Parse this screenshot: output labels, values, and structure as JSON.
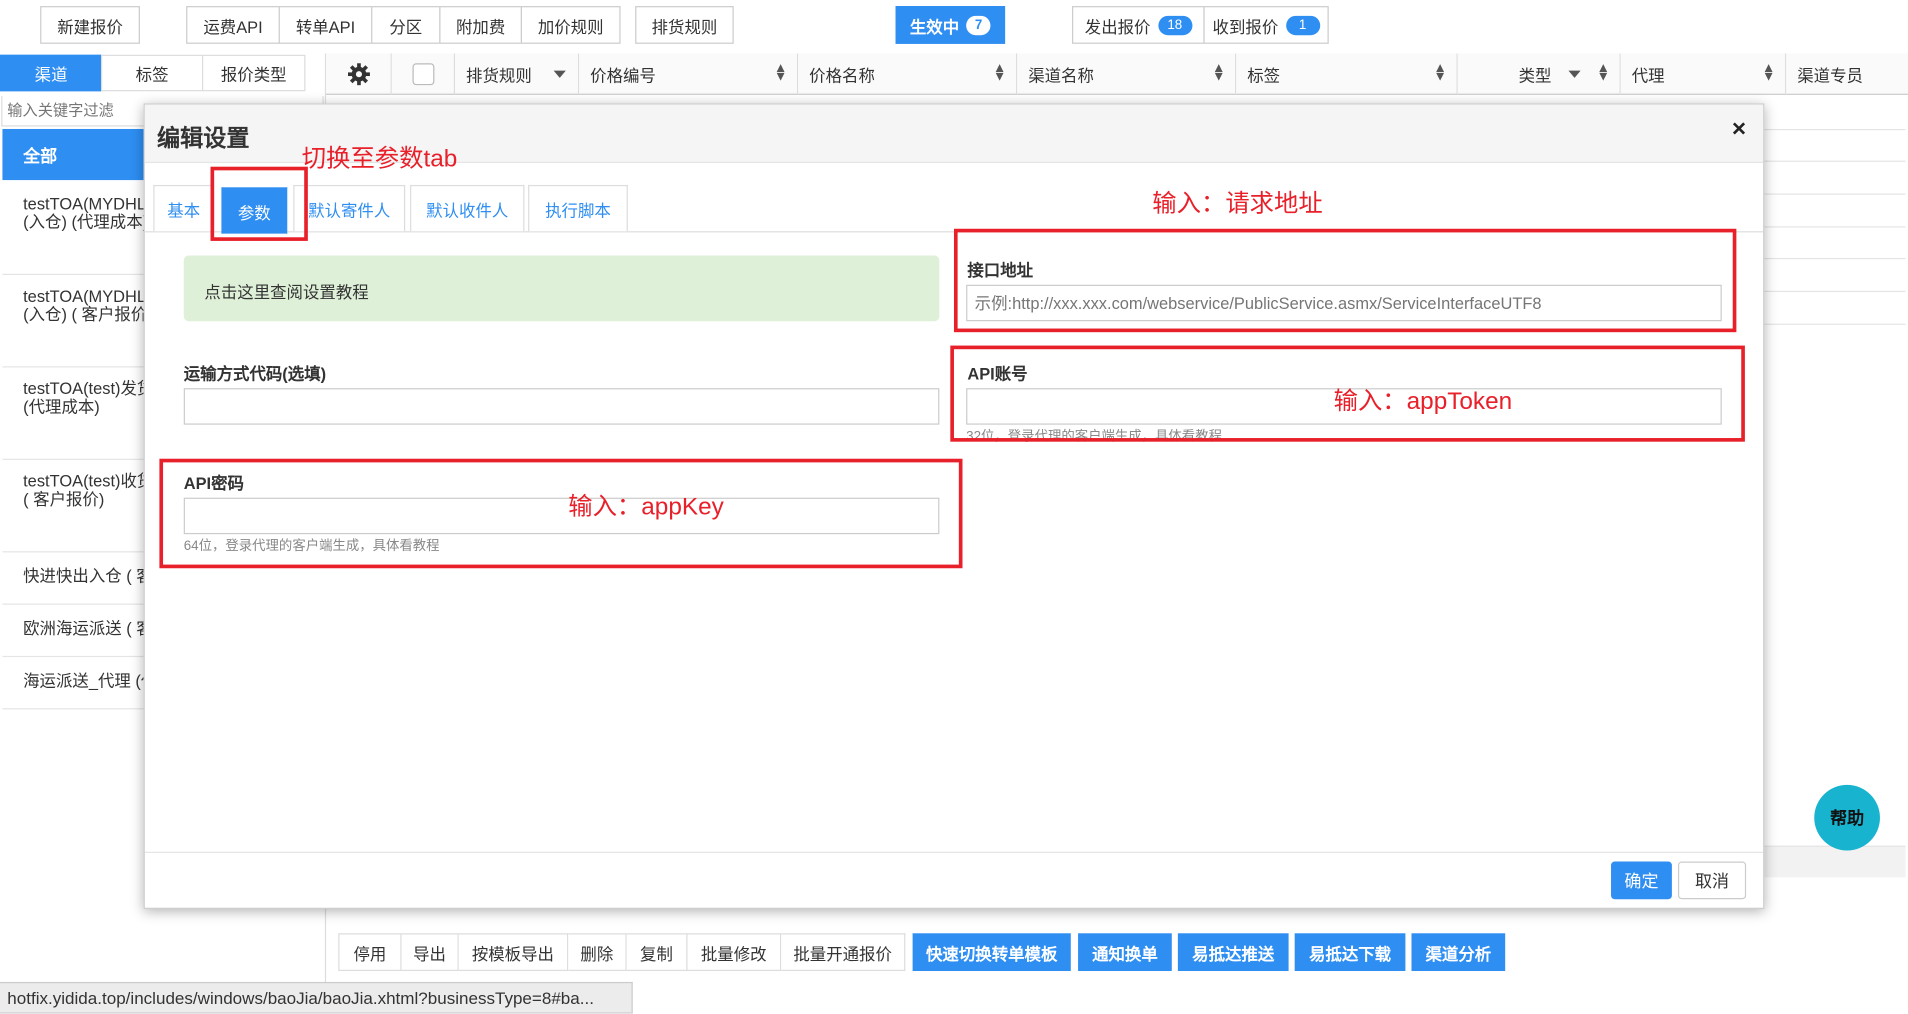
{
  "toolbar": {
    "new_quote": "新建报价",
    "freight_api": "运费API",
    "transfer_api": "转单API",
    "zone": "分区",
    "surcharge": "附加费",
    "markup_rules": "加价规则",
    "dispatch_rules": "排货规则",
    "active_label": "生效中",
    "active_count": "7",
    "sent_label": "发出报价",
    "sent_count": "18",
    "received_label": "收到报价",
    "received_count": "1"
  },
  "left_panel": {
    "tabs": [
      "渠道",
      "标签",
      "报价类型"
    ],
    "filter_placeholder": "输入关键字过滤",
    "all_label": "全部",
    "items": [
      {
        "line1": "testTOA(MYDHL",
        "line2": "(入仓) (代理成本)"
      },
      {
        "line1": "testTOA(MYDHL",
        "line2": "(入仓) ( 客户报价"
      },
      {
        "line1": "testTOA(test)发货",
        "line2": "(代理成本)"
      },
      {
        "line1": "testTOA(test)收货",
        "line2": "( 客户报价)"
      },
      {
        "line1": "快进快出入仓 ( 客",
        "line2": ""
      },
      {
        "line1": "欧洲海运派送 ( 客",
        "line2": ""
      },
      {
        "line1": "海运派送_代理 (代",
        "line2": ""
      }
    ]
  },
  "table": {
    "headers": [
      "排货规则",
      "价格编号",
      "价格名称",
      "渠道名称",
      "标签",
      "类型",
      "代理",
      "渠道专员"
    ]
  },
  "bottom_toolbar": {
    "buttons": [
      "停用",
      "导出",
      "按模板导出",
      "删除",
      "复制",
      "批量修改",
      "批量开通报价"
    ],
    "primary_buttons": [
      "快速切换转单模板",
      "通知换单",
      "易抵达推送",
      "易抵达下载",
      "渠道分析"
    ]
  },
  "help_label": "帮助",
  "status_url": "hotfix.yidida.top/includes/windows/baoJia/baoJia.xhtml?businessType=8#ba...",
  "modal": {
    "title": "编辑设置",
    "close": "×",
    "tabs": [
      "基本",
      "参数",
      "默认寄件人",
      "默认收件人",
      "执行脚本"
    ],
    "active_tab": "参数",
    "tutorial_text": "点击这里查阅设置教程",
    "endpoint_label": "接口地址",
    "endpoint_placeholder": "示例:http://xxx.xxx.com/webservice/PublicService.asmx/ServiceInterfaceUTF8",
    "shipping_code_label": "运输方式代码(选填)",
    "api_account_label": "API账号",
    "api_account_hint": "32位，登录代理的客户端生成，具体看教程",
    "api_password_label": "API密码",
    "api_password_hint": "64位，登录代理的客户端生成，具体看教程",
    "confirm": "确定",
    "cancel": "取消"
  },
  "annotations": {
    "switch_tab": "切换至参数tab",
    "input_url": "输入：请求地址",
    "input_token": "输入：appToken",
    "input_key": "输入：appKey"
  },
  "colors": {
    "primary": "#2e8ef2",
    "annotation": "#e8202a",
    "help_button": "#17b3cf",
    "tutorial_bg": "#dff0d8"
  }
}
